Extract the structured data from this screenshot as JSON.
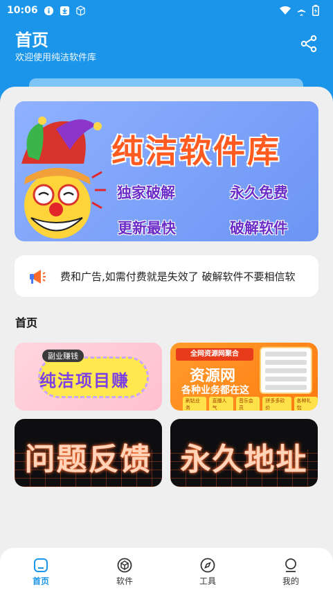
{
  "status_bar": {
    "time": "10:06"
  },
  "header": {
    "title": "首页",
    "subtitle": "欢迎使用纯洁软件库"
  },
  "banner": {
    "title": "纯洁软件库",
    "tags": [
      "独家破解",
      "永久免费",
      "更新最快",
      "破解软件"
    ]
  },
  "notice": {
    "text": "费和广告,如需付费就是失效了   破解软件不要相信软"
  },
  "section": {
    "title": "首页"
  },
  "cards": [
    {
      "tag": "副业赚钱",
      "title": "纯洁项目赚"
    },
    {
      "banner": "全网资源网聚合",
      "title": "资源网",
      "subtitle": "各种业务都在这",
      "chips": [
        "刷钻业务",
        "直播人气",
        "音乐会员",
        "拼多多砍价",
        "各种礼包"
      ]
    },
    {
      "title": "问题反馈"
    },
    {
      "title": "永久地址"
    }
  ],
  "bottom_nav": [
    {
      "label": "首页",
      "icon": "home-icon",
      "active": true
    },
    {
      "label": "软件",
      "icon": "cube-icon",
      "active": false
    },
    {
      "label": "工具",
      "icon": "compass-icon",
      "active": false
    },
    {
      "label": "我的",
      "icon": "person-icon",
      "active": false
    }
  ],
  "colors": {
    "primary": "#1a95ea",
    "banner_title": "#ff5a1f",
    "card_orange": "#ff7a10"
  }
}
